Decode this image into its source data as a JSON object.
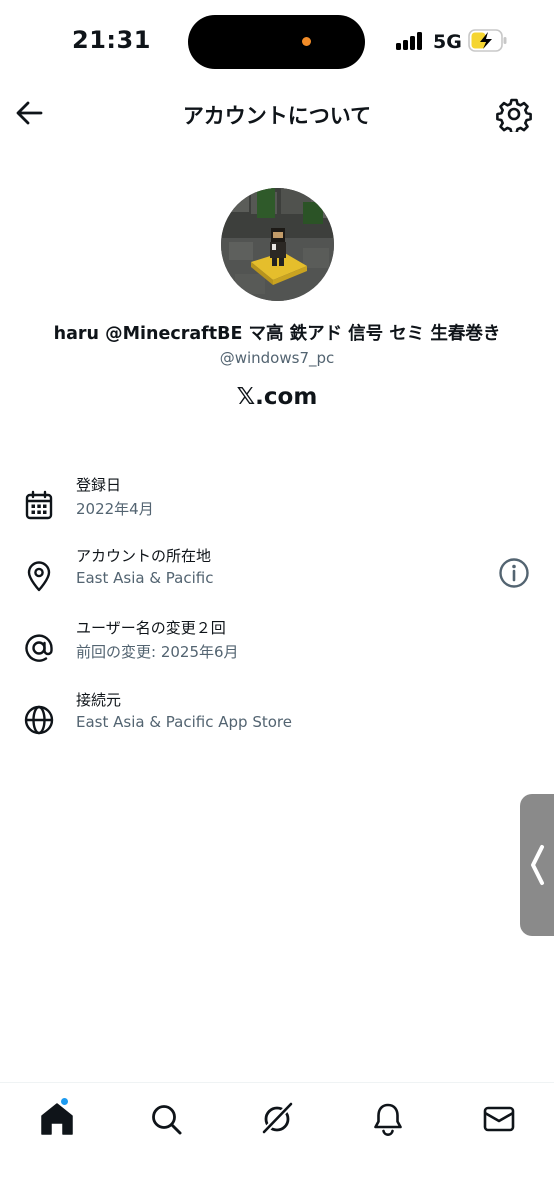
{
  "status_bar": {
    "time": "21:31",
    "network": "5G",
    "icons": [
      "signal-icon",
      "battery-charging-icon"
    ],
    "battery_color": "#f5d531",
    "island_dot_color": "#f28c28"
  },
  "header": {
    "title": "アカウントについて",
    "back_icon": "back-arrow-icon",
    "settings_icon": "gear-icon"
  },
  "profile": {
    "display_name": "haru @MinecraftBE マ高 鉄アド 信号 セミ 生春巻き",
    "handle": "@windows7_pc",
    "site": "𝕏.com"
  },
  "info": [
    {
      "icon": "calendar-icon",
      "label": "登録日",
      "value": "2022年4月"
    },
    {
      "icon": "location-pin-icon",
      "label": "アカウントの所在地",
      "value": "East Asia & Pacific",
      "action_icon": "info-icon"
    },
    {
      "icon": "at-sign-icon",
      "label": "ユーザー名の変更２回",
      "value": "前回の変更: 2025年6月"
    },
    {
      "icon": "globe-icon",
      "label": "接続元",
      "value": "East Asia & Pacific App Store"
    }
  ],
  "bottom_nav": {
    "items": [
      "home-icon",
      "search-icon",
      "grok-icon",
      "notifications-icon",
      "messages-icon"
    ],
    "badge_color": "#1d9bf0"
  },
  "side_handle": {
    "icon": "chevron-left-icon"
  }
}
